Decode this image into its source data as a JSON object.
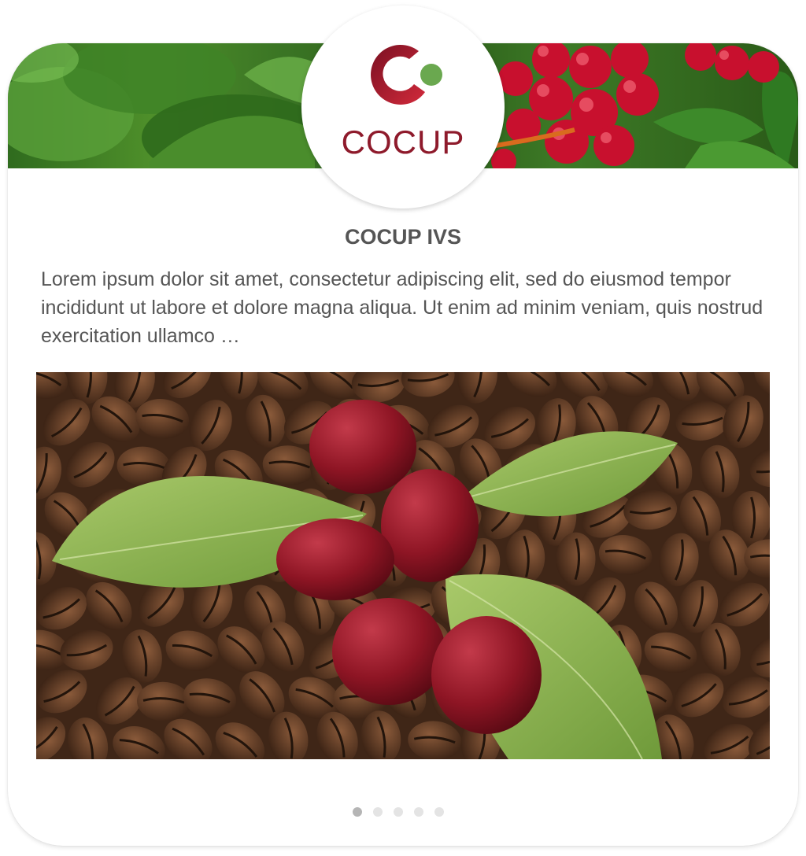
{
  "header": {
    "logo_text": "COCUP",
    "logo_colors": {
      "primary": "#8e1a2b",
      "accent": "#6aa84f"
    }
  },
  "slide": {
    "title": "COCUP IVS",
    "description": "Lorem ipsum dolor sit amet, consectetur adipiscing elit, sed do eiusmod tempor incididunt ut labore et dolore magna aliqua. Ut enim ad minim veniam, quis nostrud exercitation ullamco …"
  },
  "carousel": {
    "total": 5,
    "active_index": 0
  }
}
